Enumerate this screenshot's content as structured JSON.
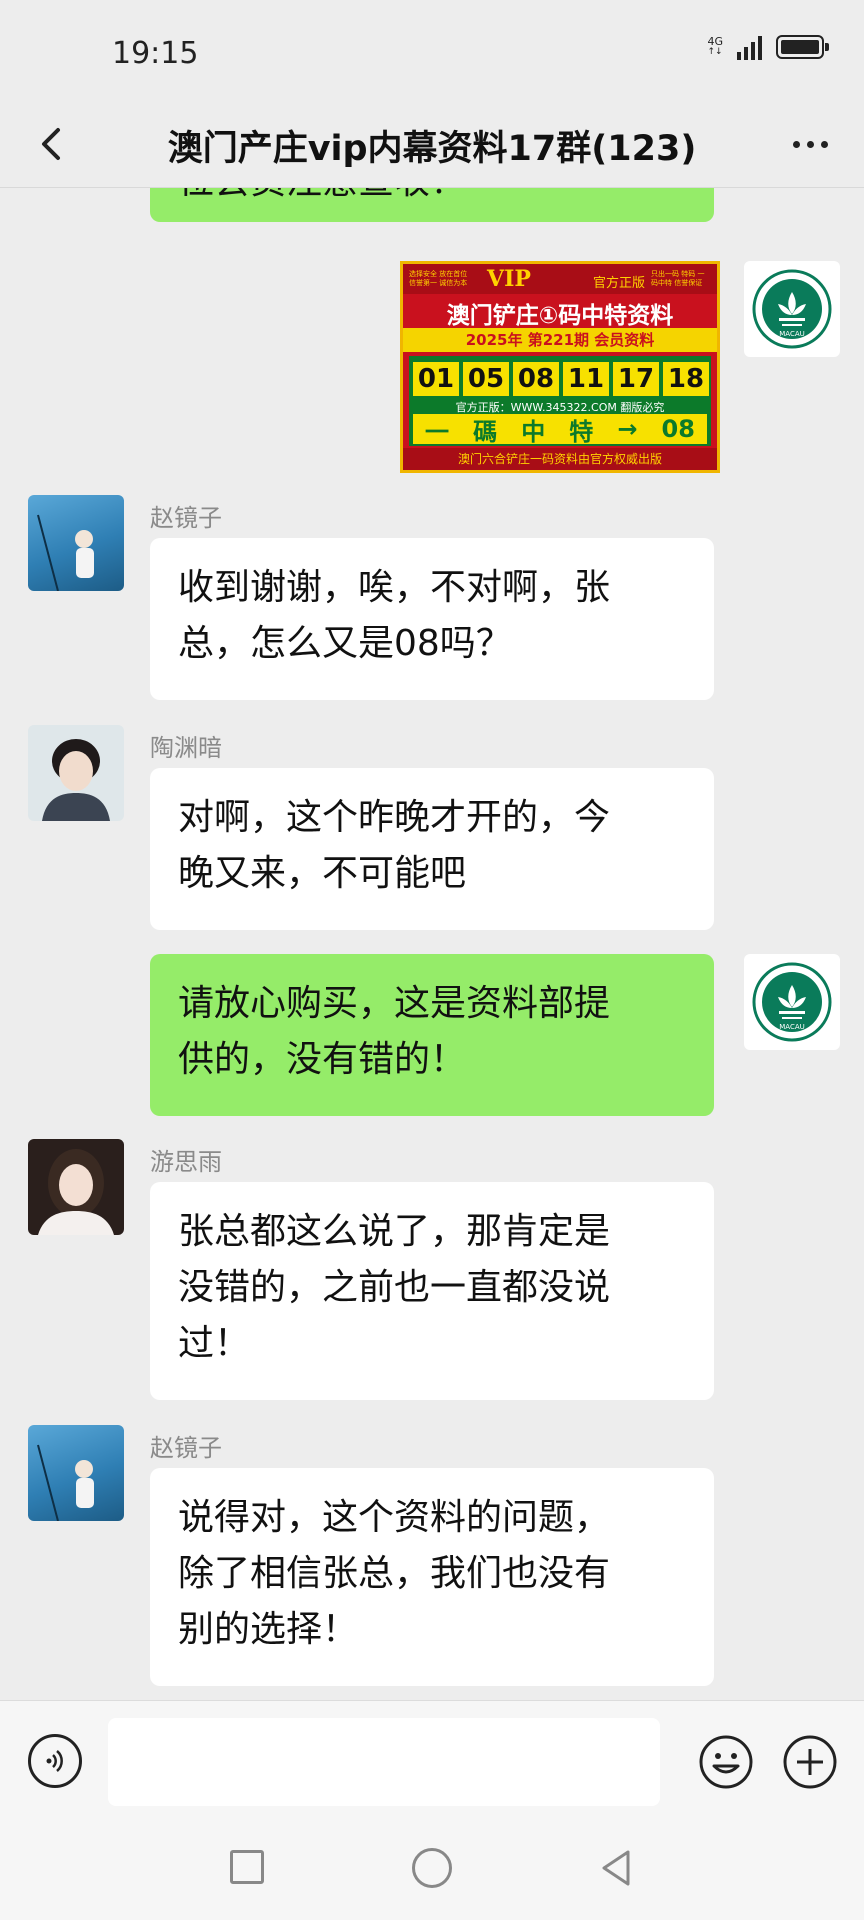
{
  "status": {
    "time": "19:15",
    "network": "4G"
  },
  "header": {
    "title": "澳门产庄vip内幕资料17群(123)"
  },
  "messages": [
    {
      "partial_text": "位会员注意查收！"
    },
    {
      "poster": {
        "vip": "VIP",
        "official": "官方正版",
        "corner_left": "选择安全 放在首位 信誉第一 诚信为本",
        "corner_right": "只出一码 特码 一码中特 信誉保证",
        "title": "澳门铲庄①码中特资料",
        "year_line": "2025年 第221期 会员资料",
        "numbers": [
          "01",
          "05",
          "08",
          "11",
          "17",
          "18"
        ],
        "site": "官方正版：WWW.345322.COM 翻版必究",
        "big_line": [
          "一",
          "碼",
          "中",
          "特",
          "→",
          "08"
        ],
        "footer": "澳门六合铲庄一码资料由官方权威出版"
      }
    },
    {
      "sender": "赵镜子",
      "lines": [
        "收到谢谢，唉，不对啊，张",
        "总，怎么又是08吗？"
      ]
    },
    {
      "sender": "陶渊暗",
      "lines": [
        "对啊，这个昨晚才开的，今",
        "晚又来，不可能吧"
      ]
    },
    {
      "lines": [
        "请放心购买，这是资料部提",
        "供的，没有错的！"
      ]
    },
    {
      "sender": "游思雨",
      "lines": [
        "张总都这么说了，那肯定是",
        "没错的，之前也一直都没说",
        "过！"
      ]
    },
    {
      "sender": "赵镜子",
      "lines": [
        "说得对，这个资料的问题，",
        "除了相信张总，我们也没有",
        "别的选择！"
      ]
    }
  ],
  "input": {
    "placeholder": ""
  },
  "logo": {
    "text": "MACAU"
  },
  "colors": {
    "out_bubble": "#95ec69",
    "in_bubble": "#ffffff",
    "background": "#ededed"
  }
}
